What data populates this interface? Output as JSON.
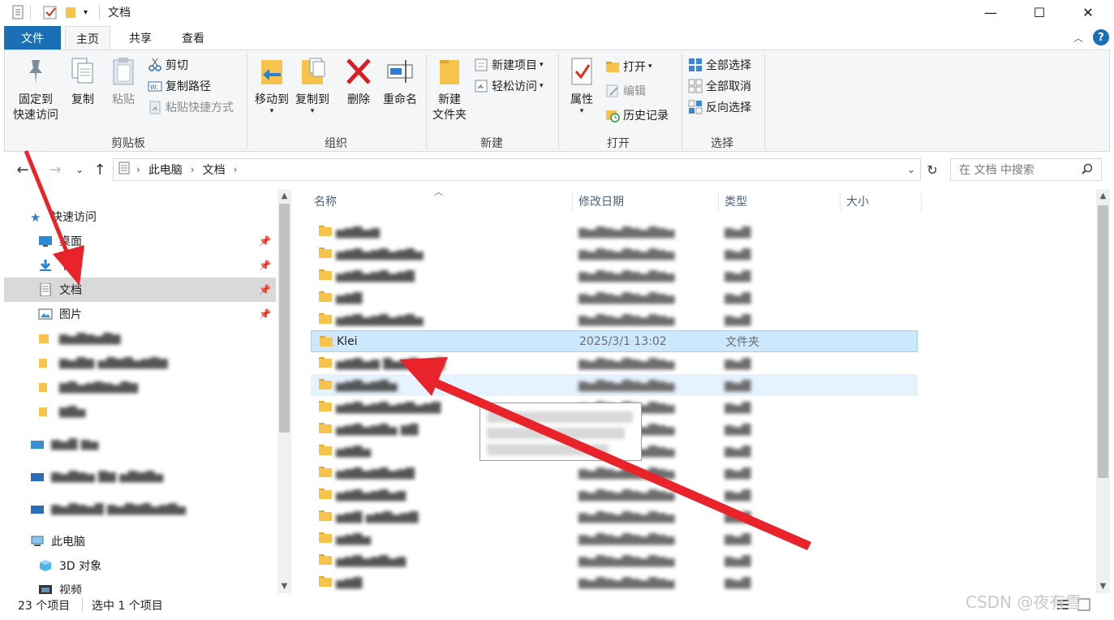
{
  "window": {
    "title": "文档",
    "controls": {
      "minimize": "—",
      "maximize": "☐",
      "close": "✕"
    }
  },
  "ribbon": {
    "tabs": [
      "文件",
      "主页",
      "共享",
      "查看"
    ],
    "clipboard": {
      "label": "剪贴板",
      "pin_line1": "固定到",
      "pin_line2": "快速访问",
      "copy": "复制",
      "paste": "粘贴",
      "cut": "剪切",
      "copy_path": "复制路径",
      "paste_shortcut": "粘贴快捷方式"
    },
    "organize": {
      "label": "组织",
      "move_to": "移动到",
      "copy_to": "复制到",
      "delete": "删除",
      "rename": "重命名"
    },
    "new": {
      "label": "新建",
      "new_folder_line1": "新建",
      "new_folder_line2": "文件夹",
      "new_item": "新建项目",
      "easy_access": "轻松访问"
    },
    "open": {
      "label": "打开",
      "properties": "属性",
      "open": "打开",
      "edit": "编辑",
      "history": "历史记录"
    },
    "select": {
      "label": "选择",
      "select_all": "全部选择",
      "select_none": "全部取消",
      "invert": "反向选择"
    }
  },
  "addressbar": {
    "crumbs": [
      "此电脑",
      "文档"
    ],
    "search_placeholder": "在 文档 中搜索"
  },
  "navpane": {
    "quick_access": "快速访问",
    "items": [
      {
        "label": "桌面",
        "pinned": true
      },
      {
        "label": "下载",
        "pinned": true
      },
      {
        "label": "文档",
        "pinned": true,
        "selected": true
      },
      {
        "label": "图片",
        "pinned": true
      }
    ],
    "this_pc": "此电脑",
    "pc_items": [
      "3D 对象",
      "视频"
    ]
  },
  "filelist": {
    "columns": {
      "name": "名称",
      "modified": "修改日期",
      "type": "类型",
      "size": "大小"
    },
    "selected_row": {
      "name": "Klei",
      "modified": "2025/3/1 13:02",
      "type": "文件夹"
    }
  },
  "status": {
    "item_count": "23 个项目",
    "selection": "选中 1 个项目"
  },
  "watermark": "CSDN @夜有雪",
  "colors": {
    "file_tab": "#1a6fb5",
    "selected_row": "#cce8ff",
    "arrow": "#e8232a"
  }
}
